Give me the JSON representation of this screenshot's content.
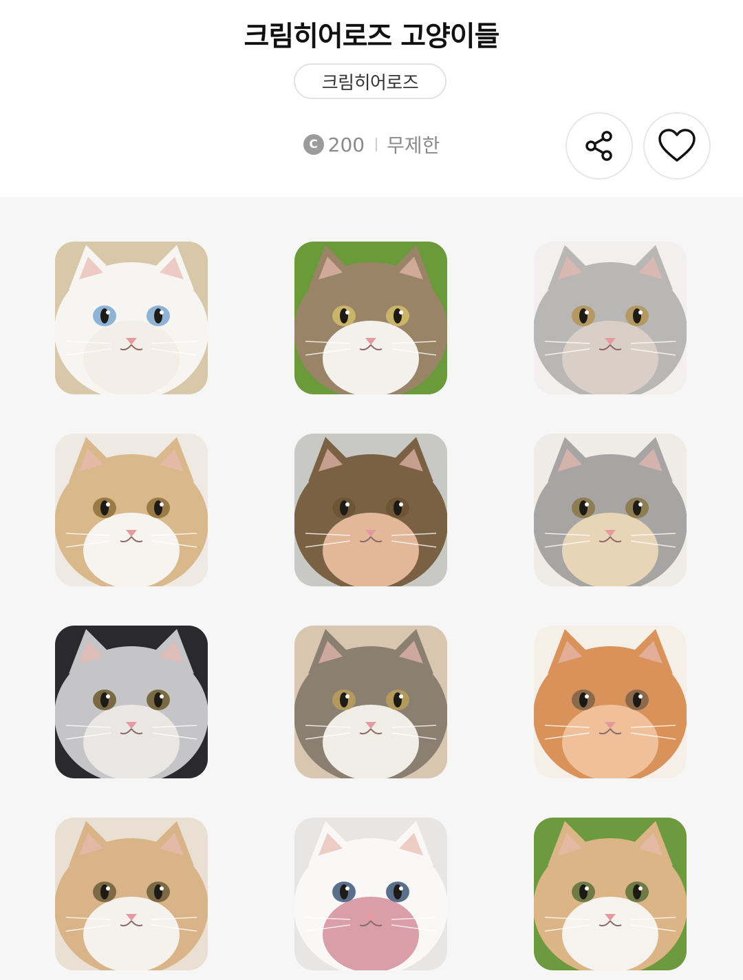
{
  "header": {
    "title": "크림히어로즈 고양이들",
    "brand": "크림히어로즈",
    "price_icon": "C",
    "price": "200",
    "period": "무제한"
  },
  "icons": {
    "share": "share-icon",
    "like": "heart-icon"
  },
  "stickers": [
    {
      "name": "white-cat-lying",
      "bg": "#d8c7a8",
      "fur": "#f7f5f2",
      "accent": "#f3eee8",
      "eye": "#8fb3d4"
    },
    {
      "name": "tabby-white-cat-licking",
      "bg": "#6a9a3a",
      "fur": "#9a8468",
      "accent": "#f4f1ec",
      "eye": "#c9b46a"
    },
    {
      "name": "silver-cat-tongue",
      "bg": "#f2efee",
      "fur": "#b9b6b6",
      "accent": "#d9cfc7",
      "eye": "#b49a62"
    },
    {
      "name": "cream-cat-wink",
      "bg": "#eee9e3",
      "fur": "#d9b98c",
      "accent": "#f7f4f0",
      "eye": "#9b7b45"
    },
    {
      "name": "brown-tabby-held",
      "bg": "#c8c8c4",
      "fur": "#7b6144",
      "accent": "#e2b79a",
      "eye": "#6d5535"
    },
    {
      "name": "cream-and-grey-cats",
      "bg": "#efece8",
      "fur": "#a7a5a4",
      "accent": "#e8d4b6",
      "eye": "#8e7d52"
    },
    {
      "name": "silver-cat-looking-up",
      "bg": "#2a2a2e",
      "fur": "#c5c4c6",
      "accent": "#e9e6e4",
      "eye": "#7a6a44"
    },
    {
      "name": "tabby-cat-surprised",
      "bg": "#d9c6b0",
      "fur": "#8b7f72",
      "accent": "#f0ece6",
      "eye": "#b39a5c"
    },
    {
      "name": "orange-cat-eating",
      "bg": "#f5efe8",
      "fur": "#d9925a",
      "accent": "#efc09a",
      "eye": "#8a6a4a"
    },
    {
      "name": "cream-cat-closeup",
      "bg": "#e9dfd2",
      "fur": "#d8b488",
      "accent": "#f5f2ee",
      "eye": "#7d6a45"
    },
    {
      "name": "white-cat-upside-down",
      "bg": "#e8e6e4",
      "fur": "#f9f8f7",
      "accent": "#d99ea8",
      "eye": "#5a6f8c"
    },
    {
      "name": "cream-cat-on-grass",
      "bg": "#6d9a3f",
      "fur": "#dcb587",
      "accent": "#f6f3ef",
      "eye": "#6f7a45"
    }
  ]
}
